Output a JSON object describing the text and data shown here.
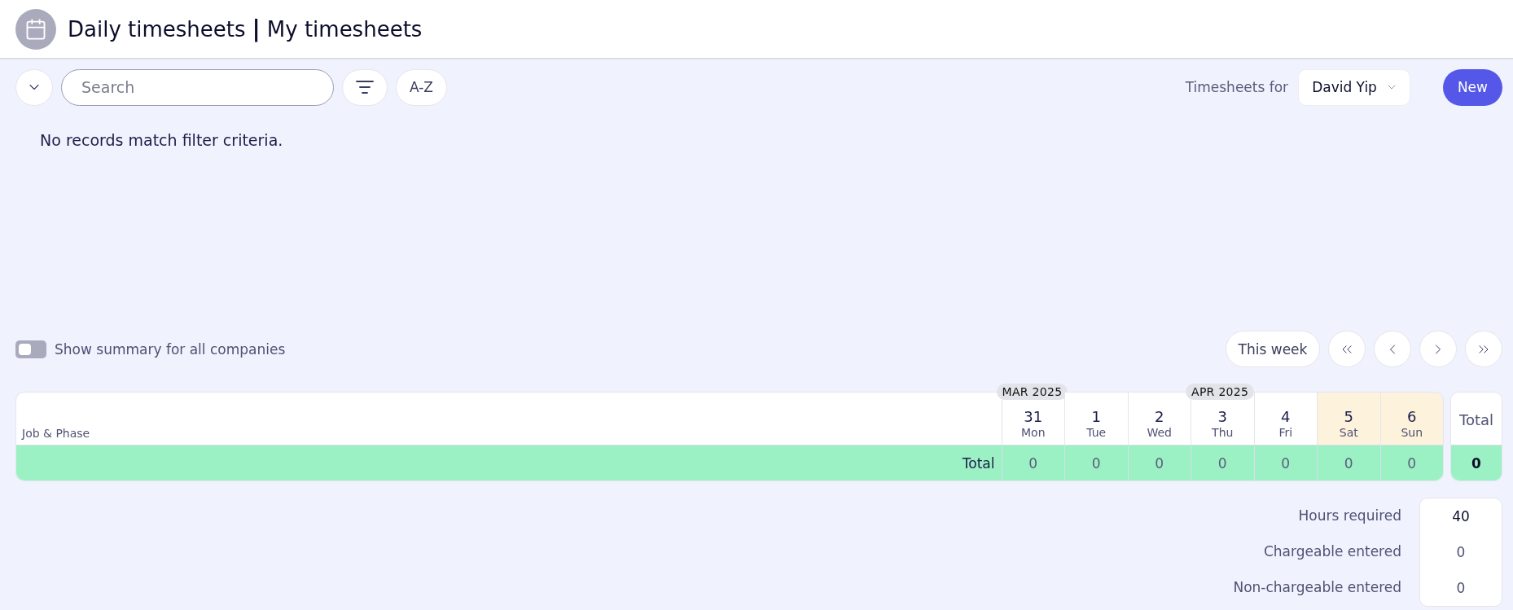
{
  "header": {
    "title": "Daily timesheets",
    "separator": "|",
    "subtitle": "My timesheets"
  },
  "toolbar": {
    "search": {
      "placeholder": "Search"
    },
    "sort_button": "A-Z",
    "timesheets_for_label": "Timesheets for",
    "person_select": "David Yip",
    "new_button": "New"
  },
  "empty_message": "No records match filter criteria.",
  "summary_toggle": {
    "label": "Show summary for all companies",
    "on": false
  },
  "week_nav": {
    "this_week_button": "This week"
  },
  "grid": {
    "first_column": "Job & Phase",
    "total_column": "Total",
    "days": [
      {
        "date": "31",
        "weekday": "Mon",
        "month_badge": "MAR 2025",
        "weekend": false
      },
      {
        "date": "1",
        "weekday": "Tue",
        "weekend": false
      },
      {
        "date": "2",
        "weekday": "Wed",
        "weekend": false
      },
      {
        "date": "3",
        "weekday": "Thu",
        "month_badge": "APR 2025",
        "weekend": false
      },
      {
        "date": "4",
        "weekday": "Fri",
        "weekend": false
      },
      {
        "date": "5",
        "weekday": "Sat",
        "weekend": true
      },
      {
        "date": "6",
        "weekday": "Sun",
        "weekend": true
      }
    ],
    "total_row": {
      "label": "Total",
      "values": [
        "0",
        "0",
        "0",
        "0",
        "0",
        "0",
        "0"
      ],
      "total": "0"
    }
  },
  "hours": [
    {
      "label": "Hours required",
      "value": "40"
    },
    {
      "label": "Chargeable entered",
      "value": "0"
    },
    {
      "label": "Non-chargeable entered",
      "value": "0"
    }
  ]
}
